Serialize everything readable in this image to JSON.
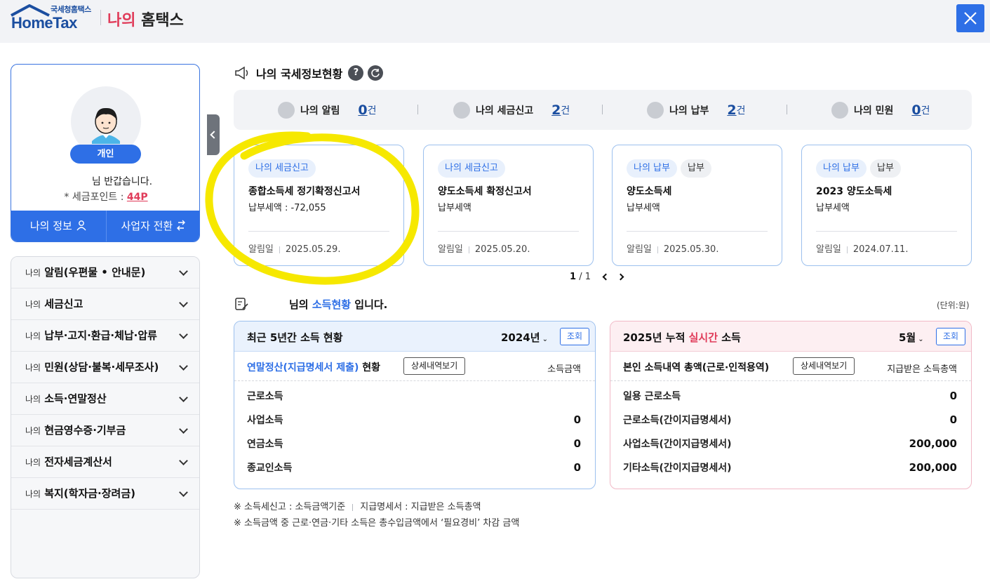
{
  "header": {
    "logo_sub": "국세청홈택스",
    "logo_main": "HomeTax",
    "title_red": "나의",
    "title_dark": "홈택스"
  },
  "profile": {
    "badge": "개인",
    "greeting_suffix": "님 반갑습니다.",
    "points_label": "* 세금포인트 : ",
    "points_value": "44P",
    "btn_my_info": "나의 정보",
    "btn_switch": "사업자 전환"
  },
  "menu": [
    {
      "prefix": "나의",
      "label": "알림(우편물 • 안내문)"
    },
    {
      "prefix": "나의",
      "label": "세금신고"
    },
    {
      "prefix": "나의",
      "label": "납부·고지·환급·체납·압류"
    },
    {
      "prefix": "나의",
      "label": "민원(상담·불복·세무조사)"
    },
    {
      "prefix": "나의",
      "label": "소득·연말정산"
    },
    {
      "prefix": "나의",
      "label": "현금영수증·기부금"
    },
    {
      "prefix": "나의",
      "label": "전자세금계산서"
    },
    {
      "prefix": "나의",
      "label": "복지(학자금·장려금)"
    }
  ],
  "status": {
    "title": "나의 국세정보현황",
    "help": "?",
    "summary": [
      {
        "label": "나의 알림",
        "count": "0",
        "unit": "건"
      },
      {
        "label": "나의 세금신고",
        "count": "2",
        "unit": "건"
      },
      {
        "label": "나의 납부",
        "count": "2",
        "unit": "건"
      },
      {
        "label": "나의 민원",
        "count": "0",
        "unit": "건"
      }
    ],
    "cards": [
      {
        "chips": [
          "나의 세금신고"
        ],
        "title": "종합소득세 정기확정신고서",
        "amount": "납부세액 : -72,055",
        "date_label": "알림일",
        "date": "2025.05.29."
      },
      {
        "chips": [
          "나의 세금신고"
        ],
        "title": "양도소득세 확정신고서",
        "amount": "납부세액",
        "date_label": "알림일",
        "date": "2025.05.20."
      },
      {
        "chips": [
          "나의 납부",
          "납부"
        ],
        "title": "양도소득세",
        "amount": "납부세액",
        "date_label": "알림일",
        "date": "2025.05.30."
      },
      {
        "chips": [
          "나의 납부",
          "납부"
        ],
        "title": "2023 양도소득세",
        "amount": "납부세액",
        "date_label": "알림일",
        "date": "2024.07.11."
      }
    ],
    "pager_current": "1",
    "pager_total": "/ 1"
  },
  "income": {
    "title_pre": "님의",
    "title_blue": "소득현황",
    "title_post": "입니다.",
    "unit": "(단위:원)",
    "left": {
      "title": "최근 5년간 소득 현황",
      "year": "2024년",
      "query": "조회",
      "sub_title_blue": "연말정산(지급명세서 제출)",
      "sub_title_post": " 현황",
      "detail_btn": "상세내역보기",
      "col": "소득금액",
      "rows": [
        {
          "k": "근로소득",
          "v": ""
        },
        {
          "k": "사업소득",
          "v": "0"
        },
        {
          "k": "연금소득",
          "v": "0"
        },
        {
          "k": "종교인소득",
          "v": "0"
        }
      ]
    },
    "right": {
      "title_pre": "2025년 누적 ",
      "title_red": "실시간",
      "title_post": " 소득",
      "month": "5월",
      "query": "조회",
      "sub_title": "본인 소득내역 총액(근로·인적용역)",
      "detail_btn": "상세내역보기",
      "col": "지급받은 소득총액",
      "rows": [
        {
          "k": "일용 근로소득",
          "v": "0"
        },
        {
          "k": "근로소득(간이지급명세서)",
          "v": "0"
        },
        {
          "k": "사업소득(간이지급명세서)",
          "v": "200,000"
        },
        {
          "k": "기타소득(간이지급명세서)",
          "v": "200,000"
        }
      ]
    },
    "note1a": "※ 소득세신고 : 소득금액기준",
    "note1b": "지급명세서 : 지급받은 소득총액",
    "note2": "※ 소득금액 중 근로·연금·기타 소득은 총수입금액에서 ‘필요경비’ 차감 금액"
  },
  "colors": {
    "primary": "#2e6fe6",
    "red": "#e03c5a",
    "highlight": "#f6e800"
  }
}
